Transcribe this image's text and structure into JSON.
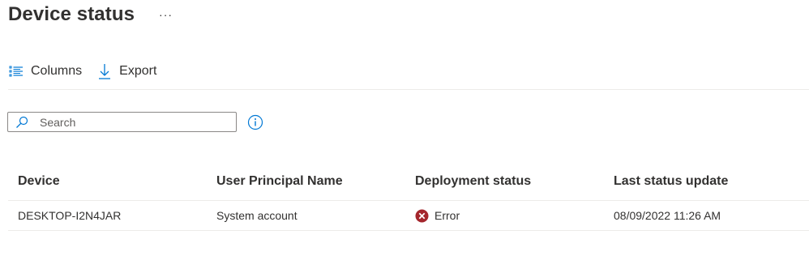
{
  "page": {
    "title": "Device status",
    "more_label": "···"
  },
  "toolbar": {
    "columns_label": "Columns",
    "export_label": "Export",
    "icon_color": "#0078d4"
  },
  "search": {
    "placeholder": "Search",
    "value": ""
  },
  "info": {
    "icon": "info-icon"
  },
  "table": {
    "columns": [
      "Device",
      "User Principal Name",
      "Deployment status",
      "Last status update"
    ],
    "rows": [
      {
        "device": "DESKTOP-I2N4JAR",
        "upn": "System account",
        "status": "Error",
        "status_icon": "error-circle-icon",
        "status_color": "#a4262c",
        "last_update": "08/09/2022 11:26 AM"
      }
    ]
  }
}
